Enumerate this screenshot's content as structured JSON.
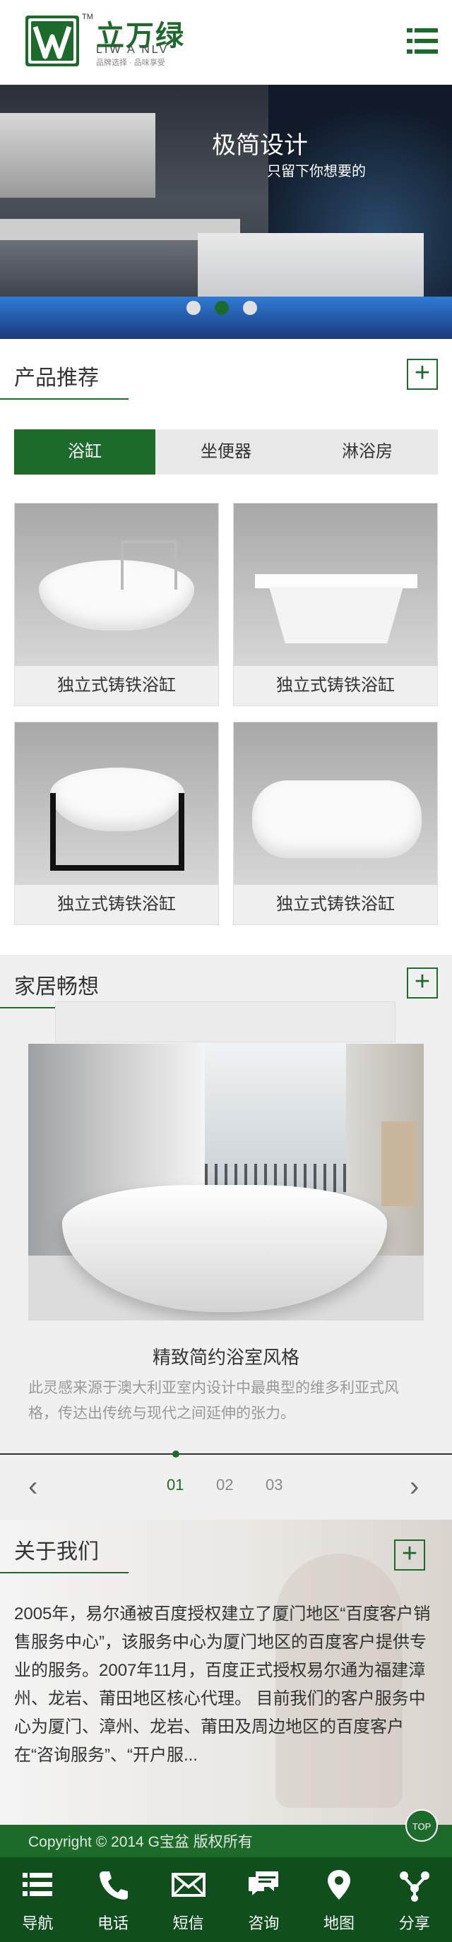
{
  "header": {
    "logo_tm": "TM",
    "brand_cn": "立万绿",
    "brand_en": "LIW A NLV",
    "slogan": "品牌选择 · 品味享受"
  },
  "banner": {
    "title": "极简设计",
    "subtitle": "只留下你想要的",
    "slide_count": 3,
    "active_slide": 2
  },
  "products": {
    "section_title": "产品推荐",
    "tabs": [
      "浴缸",
      "坐便器",
      "淋浴房"
    ],
    "active_tab": 0,
    "items": [
      {
        "label": "独立式铸铁浴缸"
      },
      {
        "label": "独立式铸铁浴缸"
      },
      {
        "label": "独立式铸铁浴缸"
      },
      {
        "label": "独立式铸铁浴缸"
      }
    ]
  },
  "ideas": {
    "section_title": "家居畅想",
    "title": "精致简约浴室风格",
    "description": "此灵感来源于澳大利亚室内设计中最典型的维多利亚式风格，传达出传统与现代之间延伸的张力。",
    "pages": [
      "01",
      "02",
      "03"
    ],
    "active_page": 0,
    "prev_arrow": "‹",
    "next_arrow": "›"
  },
  "about": {
    "section_title": "关于我们",
    "text": "2005年，易尔通被百度授权建立了厦门地区“百度客户销售服务中心”，该服务中心为厦门地区的百度客户提供专业的服务。2007年11月，百度正式授权易尔通为福建漳州、龙岩、莆田地区核心代理。 目前我们的客户服务中心为厦门、漳州、龙岩、莆田及周边地区的百度客户在“咨询服务”、“开户服..."
  },
  "footer": {
    "copyright": "Copyright © 2014 G宝盆 版权所有",
    "top_label": "TOP",
    "nav": [
      {
        "label": "导航",
        "icon": "list-icon"
      },
      {
        "label": "电话",
        "icon": "phone-icon"
      },
      {
        "label": "短信",
        "icon": "mail-icon"
      },
      {
        "label": "咨询",
        "icon": "chat-icon"
      },
      {
        "label": "地图",
        "icon": "map-pin-icon"
      },
      {
        "label": "分享",
        "icon": "share-icon"
      }
    ]
  },
  "colors": {
    "brand_green": "#1d6b2a",
    "nav_green": "#0e4f1c"
  }
}
